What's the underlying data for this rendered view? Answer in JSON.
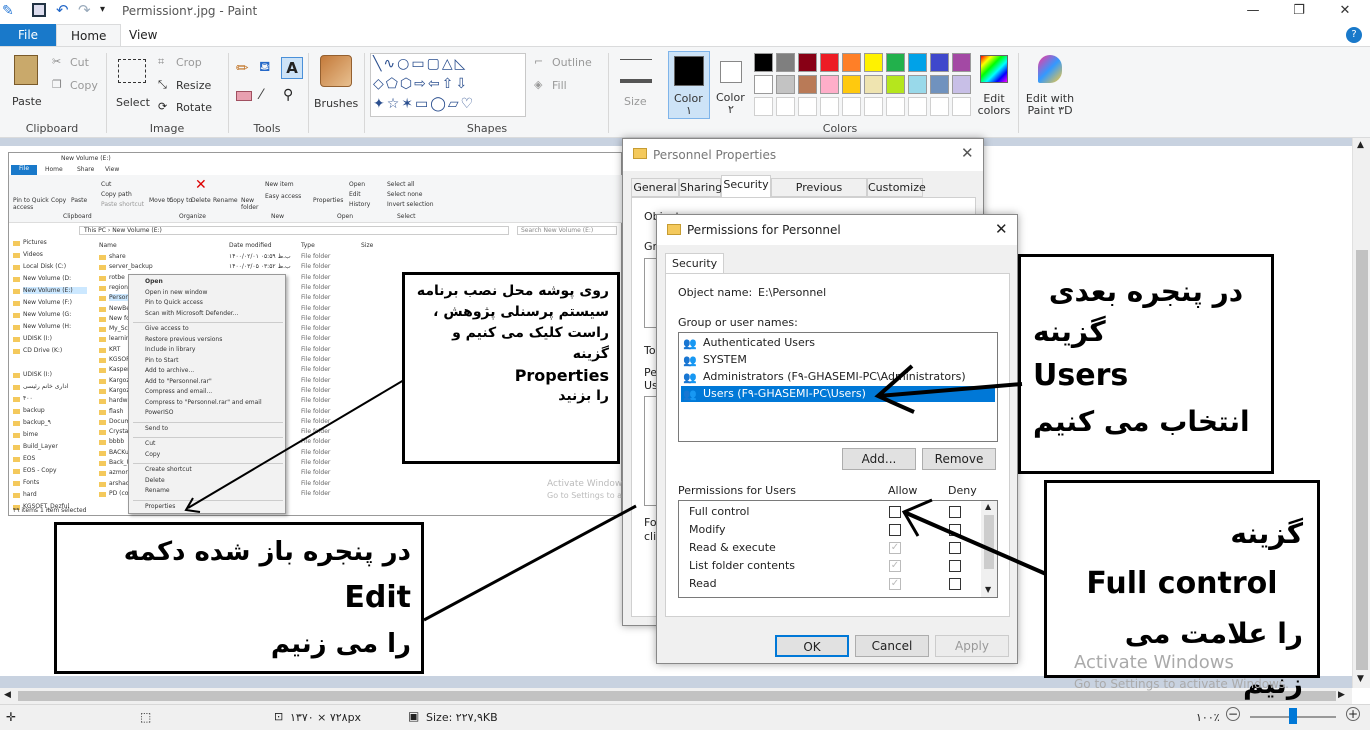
{
  "app": {
    "title": "Permission۲.jpg - Paint"
  },
  "menu": {
    "file": "File",
    "home": "Home",
    "view": "View"
  },
  "ribbon": {
    "paste": "Paste",
    "cut": "Cut",
    "copy": "Copy",
    "clipboard": "Clipboard",
    "select": "Select",
    "crop": "Crop",
    "resize": "Resize",
    "rotate": "Rotate",
    "image": "Image",
    "tools": "Tools",
    "brushes": "Brushes",
    "outline": "Outline",
    "fill": "Fill",
    "shapes": "Shapes",
    "size": "Size",
    "color1": "Color",
    "color1_num": "۱",
    "color2": "Color",
    "color2_num": "۲",
    "edit_colors": "Edit colors",
    "edit_paint3d": "Edit with Paint ۳D",
    "colors": "Colors",
    "palette": [
      "#000000",
      "#7f7f7f",
      "#880015",
      "#ed1c24",
      "#ff7f27",
      "#fff200",
      "#22b14c",
      "#00a2e8",
      "#3f48cc",
      "#a349a4",
      "#ffffff",
      "#c3c3c3",
      "#b97a57",
      "#ffaec9",
      "#ffc90e",
      "#efe4b0",
      "#b5e61d",
      "#99d9ea",
      "#7092be",
      "#c8bfe7"
    ]
  },
  "explorer": {
    "path_title": "New Volume (E:)",
    "tabs": [
      "File",
      "Home",
      "Share",
      "View"
    ],
    "ribbon_btns": [
      "Pin to Quick access",
      "Copy",
      "Paste",
      "Move to",
      "Copy to",
      "Delete",
      "Rename",
      "New folder",
      "Properties"
    ],
    "ribbon_small": [
      "Cut",
      "Copy path",
      "Paste shortcut",
      "New item",
      "Easy access",
      "Open",
      "Edit",
      "History",
      "Select all",
      "Select none",
      "Invert selection"
    ],
    "groups": [
      "Clipboard",
      "Organize",
      "New",
      "Open",
      "Select"
    ],
    "address": "This PC  ›  New Volume (E:)",
    "search": "Search New Volume (E:)",
    "nav": [
      "Pictures",
      "Videos",
      "Local Disk (C:)",
      "New Volume (D:",
      "New Volume (E:)",
      "New Volume (F:)",
      "New Volume (G:",
      "New Volume (H:",
      "UDISK (I:)",
      "CD Drive (K:)",
      "",
      "UDISK (I:)",
      "اداری خانم رئیسی",
      "۴۰۰",
      "backup",
      "backup_۹",
      "bime",
      "Build_Layer",
      "EOS",
      "EOS - Copy",
      "Fonts",
      "hard",
      "KGSOFT_Dezful"
    ],
    "cols": [
      "Name",
      "Date modified",
      "Type",
      "Size"
    ],
    "files": [
      "share",
      "server_backup",
      "rotbe",
      "region",
      "Personnel",
      "NewBe",
      "New fo",
      "My_Sc",
      "learnin",
      "KRT",
      "KGSOF",
      "Kasperi",
      "Kargoz",
      "Kargoz",
      "hardwa",
      "flash",
      "Docum",
      "Crystal",
      "bbbb",
      "BACKup",
      "Back_U",
      "azmon",
      "arshad",
      "PD (co"
    ],
    "dates": [
      "۱۴۰۰/۰۲/۰۱ ب.ظ ۰۵:۵۹",
      "۱۴۰۰/۰۳/۰۵ ب.ظ ۰۳:۵۲",
      "",
      "",
      "",
      "",
      "",
      "",
      "",
      "",
      "",
      "",
      "",
      "",
      "",
      "",
      "",
      "",
      "",
      "",
      "",
      "",
      "",
      ""
    ],
    "type": "File folder",
    "status": "۴۹ items    1 item selected",
    "activate": "Activate Window",
    "activate2": "Go to Settings to activ"
  },
  "context_menu": [
    "Open",
    "Open in new window",
    "Pin to Quick access",
    "Scan with Microsoft Defender...",
    "",
    "Give access to",
    "Restore previous versions",
    "Include in library",
    "Pin to Start",
    "Add to archive...",
    "Add to \"Personnel.rar\"",
    "Compress and email...",
    "Compress to \"Personnel.rar\" and email",
    "PowerISO",
    "",
    "Send to",
    "",
    "Cut",
    "Copy",
    "",
    "Create shortcut",
    "Delete",
    "Rename",
    "",
    "Properties"
  ],
  "props": {
    "title": "Personnel Properties",
    "tabs": [
      "General",
      "Sharing",
      "Security",
      "Previous Versions",
      "Customize"
    ],
    "object_label": "Object name:",
    "object_value": "E:\\Personnel",
    "to": "To",
    "pe": "Pe",
    "us": "Us",
    "fo": "For",
    "cli": "clic",
    "gr": "Gr"
  },
  "perm": {
    "title": "Permissions for Personnel",
    "tab": "Security",
    "object_label": "Object name:",
    "object_value": "E:\\Personnel",
    "groups_label": "Group or user names:",
    "users": [
      "Authenticated Users",
      "SYSTEM",
      "Administrators (F۹-GHASEMI-PC\\Administrators)",
      "Users (F۹-GHASEMI-PC\\Users)"
    ],
    "add": "Add...",
    "remove": "Remove",
    "perm_label": "Permissions for Users",
    "allow": "Allow",
    "deny": "Deny",
    "rows": [
      "Full control",
      "Modify",
      "Read & execute",
      "List folder contents",
      "Read"
    ],
    "ok": "OK",
    "cancel": "Cancel",
    "apply": "Apply"
  },
  "callouts": {
    "c1": [
      "روی پوشه محل نصب برنامه",
      "سیستم پرسنلی پژوهش ،",
      "راست کلیک می کنیم و گزینه",
      "Properties",
      "را بزنید"
    ],
    "c2": [
      "در پنجره باز شده دکمه",
      "Edit",
      "را می زنیم"
    ],
    "c3": [
      "در پنجره بعدی",
      "گزینه",
      "Users",
      "انتخاب می کنیم"
    ],
    "c4": [
      "گزینه",
      "Full control",
      "را علامت می زنیم"
    ]
  },
  "watermark": {
    "line1": "Activate Windows",
    "line2": "Go to Settings to activate Windows."
  },
  "status": {
    "dimensions": "۱۳۷۰ × ۷۲۸px",
    "size": "Size: ۲۲۷,۹KB",
    "zoom": "۱۰۰٪"
  }
}
